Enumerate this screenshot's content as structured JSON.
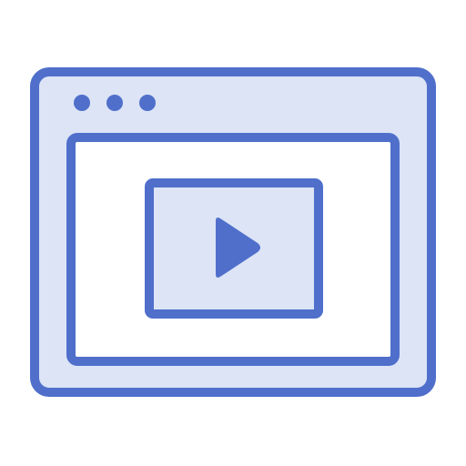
{
  "icon": {
    "name": "browser-video-player-icon",
    "colors": {
      "stroke": "#4F6FCB",
      "fill": "#DCE4F6",
      "background": "#FFFFFF",
      "inner_panel": "#FFFFFF"
    },
    "parts": {
      "window_dots": 3,
      "has_play_button": true
    }
  }
}
